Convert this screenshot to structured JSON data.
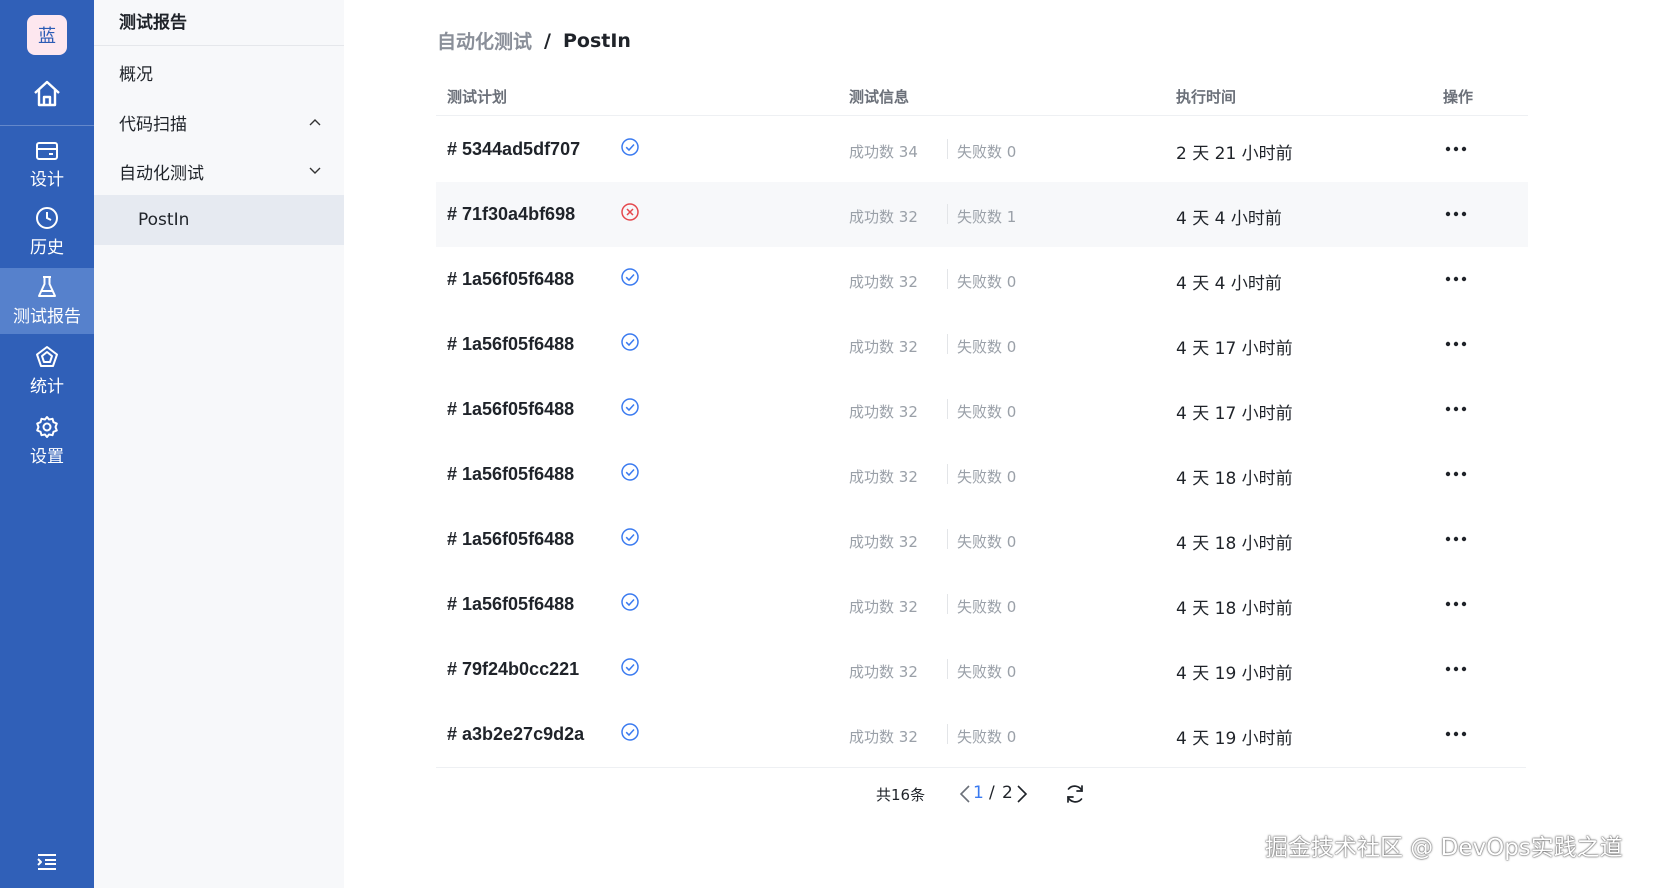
{
  "rail": {
    "logo": "蓝",
    "items": [
      {
        "label": "设计",
        "icon": "card-icon"
      },
      {
        "label": "历史",
        "icon": "clock-icon"
      },
      {
        "label": "测试报告",
        "icon": "flask-icon",
        "active": true
      },
      {
        "label": "统计",
        "icon": "pentagon-chart-icon"
      },
      {
        "label": "设置",
        "icon": "gear-icon"
      }
    ]
  },
  "sidebar": {
    "title": "测试报告",
    "items": [
      {
        "label": "概况"
      },
      {
        "label": "代码扫描",
        "chevron": "up"
      },
      {
        "label": "自动化测试",
        "chevron": "down"
      },
      {
        "label": "PostIn",
        "selected": true
      }
    ]
  },
  "breadcrumb": {
    "parent": "自动化测试",
    "separator": "/",
    "current": "PostIn"
  },
  "table": {
    "headers": {
      "plan": "测试计划",
      "info": "测试信息",
      "time": "执行时间",
      "action": "操作"
    },
    "success_label": "成功数",
    "fail_label": "失败数",
    "rows": [
      {
        "plan": "# 5344ad5df707",
        "status": "success",
        "success": "34",
        "fail": "0",
        "time": "2 天 21 小时前"
      },
      {
        "plan": "# 71f30a4bf698",
        "status": "failed",
        "success": "32",
        "fail": "1",
        "time": "4 天 4 小时前"
      },
      {
        "plan": "# 1a56f05f6488",
        "status": "success",
        "success": "32",
        "fail": "0",
        "time": "4 天 4 小时前"
      },
      {
        "plan": "# 1a56f05f6488",
        "status": "success",
        "success": "32",
        "fail": "0",
        "time": "4 天 17 小时前"
      },
      {
        "plan": "# 1a56f05f6488",
        "status": "success",
        "success": "32",
        "fail": "0",
        "time": "4 天 17 小时前"
      },
      {
        "plan": "# 1a56f05f6488",
        "status": "success",
        "success": "32",
        "fail": "0",
        "time": "4 天 18 小时前"
      },
      {
        "plan": "# 1a56f05f6488",
        "status": "success",
        "success": "32",
        "fail": "0",
        "time": "4 天 18 小时前"
      },
      {
        "plan": "# 1a56f05f6488",
        "status": "success",
        "success": "32",
        "fail": "0",
        "time": "4 天 18 小时前"
      },
      {
        "plan": "# 79f24b0cc221",
        "status": "success",
        "success": "32",
        "fail": "0",
        "time": "4 天 19 小时前"
      },
      {
        "plan": "# a3b2e27c9d2a",
        "status": "success",
        "success": "32",
        "fail": "0",
        "time": "4 天 19 小时前"
      }
    ]
  },
  "pagination": {
    "total": "共16条",
    "current": "1",
    "separator": "/",
    "pages": "2"
  },
  "watermark": "掘金技术社区 @ DevOps实践之道",
  "colors": {
    "rail": "#3060b8",
    "rail_active": "#5681cc",
    "success": "#3a7af0",
    "failed": "#e5484d",
    "accent": "#3a7af0"
  }
}
